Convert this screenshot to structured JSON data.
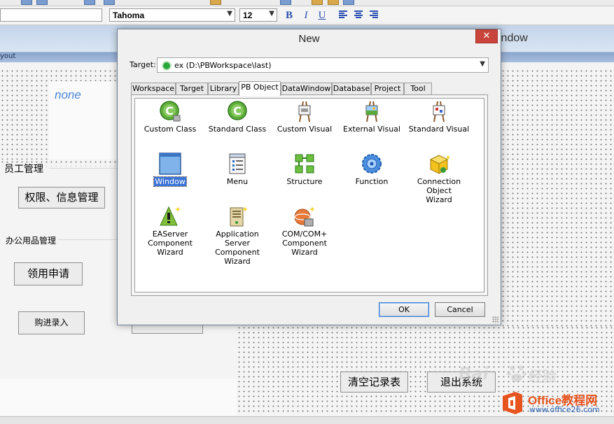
{
  "format_bar": {
    "font_name": "Tahoma",
    "font_size": "12",
    "bold_label": "B",
    "italic_label": "I",
    "underline_label": "U"
  },
  "background": {
    "window_title_fragment": "indow",
    "layout_tab_fragment": "yout",
    "none_text": "none",
    "group_staff": "员工管理",
    "btn_permissions": "权限、信息管理",
    "group_office": "办公用品管理",
    "btn_apply": "领用申请",
    "btn_purchase": "购进录入",
    "btn_clear": "清空记录表",
    "btn_exit": "退出系统"
  },
  "dialog": {
    "title": "New",
    "close_glyph": "✕",
    "target_label": "Target:",
    "target_value": "ex (D:\\PBWorkspace\\last)",
    "tabs": [
      "Workspace",
      "Target",
      "Library",
      "PB Object",
      "DataWindow",
      "Database",
      "Project",
      "Tool"
    ],
    "active_tab": "PB Object",
    "items": [
      {
        "label": "Custom Class",
        "icon": "custom-class-icon"
      },
      {
        "label": "Standard Class",
        "icon": "standard-class-icon"
      },
      {
        "label": "Custom Visual",
        "icon": "custom-visual-icon"
      },
      {
        "label": "External Visual",
        "icon": "external-visual-icon"
      },
      {
        "label": "Standard Visual",
        "icon": "standard-visual-icon"
      },
      {
        "label": "Window",
        "icon": "window-icon"
      },
      {
        "label": "Menu",
        "icon": "menu-icon"
      },
      {
        "label": "Structure",
        "icon": "structure-icon"
      },
      {
        "label": "Function",
        "icon": "function-icon"
      },
      {
        "label_line1": "Connection Object",
        "label_line2": "Wizard",
        "icon": "connection-wizard-icon"
      },
      {
        "label_line1": "EAServer",
        "label_line2": "Component Wizard",
        "icon": "easerver-wizard-icon"
      },
      {
        "label_line1": "Application Server",
        "label_line2": "Component Wizard",
        "icon": "app-server-wizard-icon"
      },
      {
        "label_line1": "COM/COM+",
        "label_line2": "Component Wizard",
        "icon": "com-wizard-icon"
      }
    ],
    "selected_item": "Window",
    "ok_label": "OK",
    "cancel_label": "Cancel"
  },
  "watermark": {
    "baidu_text": "Bai",
    "baidu_suffix": "经验",
    "office_brand": "Office教程网",
    "office_url": "www.office26.com"
  },
  "colors": {
    "selection": "#3b73d6",
    "close_button": "#c9453b",
    "title_gradient_top": "#c3d4ea",
    "link_blue": "#4a86d8"
  }
}
